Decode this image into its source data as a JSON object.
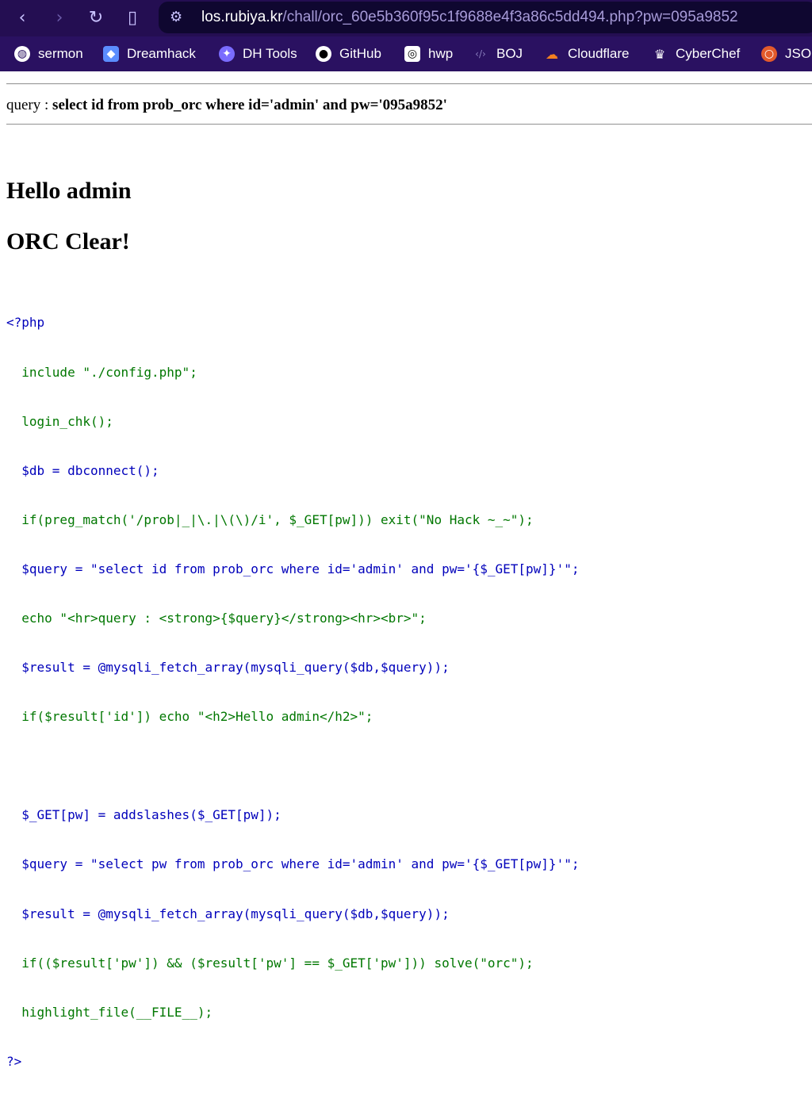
{
  "browser": {
    "url_host": "los.rubiya.kr",
    "url_path": "/chall/orc_60e5b360f95c1f9688e4f3a86c5dd494.php?pw=095a9852",
    "bookmarks": [
      {
        "label": "sermon",
        "icon": "globe-icon"
      },
      {
        "label": "Dreamhack",
        "icon": "dreamhack-icon"
      },
      {
        "label": "DH Tools",
        "icon": "dhtools-icon"
      },
      {
        "label": "GitHub",
        "icon": "github-icon"
      },
      {
        "label": "hwp",
        "icon": "hwp-icon"
      },
      {
        "label": "BOJ",
        "icon": "boj-icon"
      },
      {
        "label": "Cloudflare",
        "icon": "cloudflare-icon"
      },
      {
        "label": "CyberChef",
        "icon": "cyberchef-icon"
      },
      {
        "label": "JSO",
        "icon": "jso-icon"
      }
    ]
  },
  "page": {
    "query_prefix": "query : ",
    "query_text": "select id from prob_orc where id='admin' and pw='095a9852'",
    "heading_hello": "Hello admin",
    "heading_clear": "ORC Clear!",
    "code_lines": [
      "<?php",
      "  include \"./config.php\";",
      "  login_chk();",
      "  $db = dbconnect();",
      "  if(preg_match('/prob|_|\\.|\\(\\)/i', $_GET[pw])) exit(\"No Hack ~_~\");",
      "  $query = \"select id from prob_orc where id='admin' and pw='{$_GET[pw]}'\";",
      "  echo \"<hr>query : <strong>{$query}</strong><hr><br>\";",
      "  $result = @mysqli_fetch_array(mysqli_query($db,$query));",
      "  if($result['id']) echo \"<h2>Hello admin</h2>\";",
      "",
      "  $_GET[pw] = addslashes($_GET[pw]);",
      "  $query = \"select pw from prob_orc where id='admin' and pw='{$_GET[pw]}'\";",
      "  $result = @mysqli_fetch_array(mysqli_query($db,$query));",
      "  if(($result['pw']) && ($result['pw'] == $_GET['pw'])) solve(\"orc\");",
      "  highlight_file(__FILE__);",
      "?>"
    ]
  },
  "colors": {
    "keyword": "#0000bb",
    "default": "#007700",
    "string": "#dd0000",
    "chrome_bg": "#240e52",
    "bookmarks_bg": "#2a1161"
  }
}
